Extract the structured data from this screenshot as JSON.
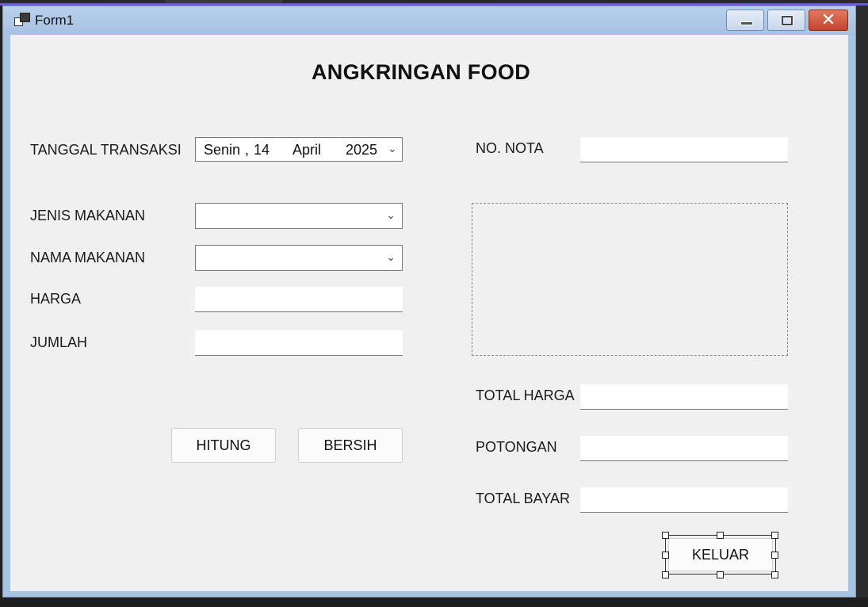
{
  "window": {
    "title": "Form1"
  },
  "form": {
    "heading": "ANGKRINGAN FOOD",
    "labels": {
      "tanggal": "TANGGAL TRANSAKSI",
      "jenis": "JENIS MAKANAN",
      "nama": "NAMA MAKANAN",
      "harga": "HARGA",
      "jumlah": "JUMLAH",
      "nota": "NO. NOTA",
      "total_harga": "TOTAL HARGA",
      "potongan": "POTONGAN",
      "total_bayar": "TOTAL BAYAR"
    },
    "date": {
      "day_name": "Senin",
      "sep": ",",
      "day": "14",
      "month": "April",
      "year": "2025"
    },
    "buttons": {
      "hitung": "HITUNG",
      "bersih": "BERSIH",
      "keluar": "KELUAR"
    }
  },
  "colors": {
    "title_bar": "#a9c4e3",
    "client_bg": "#f0f0f0",
    "close_button": "#c2432b",
    "accent_strip": "#6b5fc7"
  },
  "icons": {
    "app": "form-window-icon",
    "minimize": "minimize-icon",
    "maximize": "maximize-icon",
    "close": "close-icon",
    "dropdown": "chevron-down-icon"
  }
}
